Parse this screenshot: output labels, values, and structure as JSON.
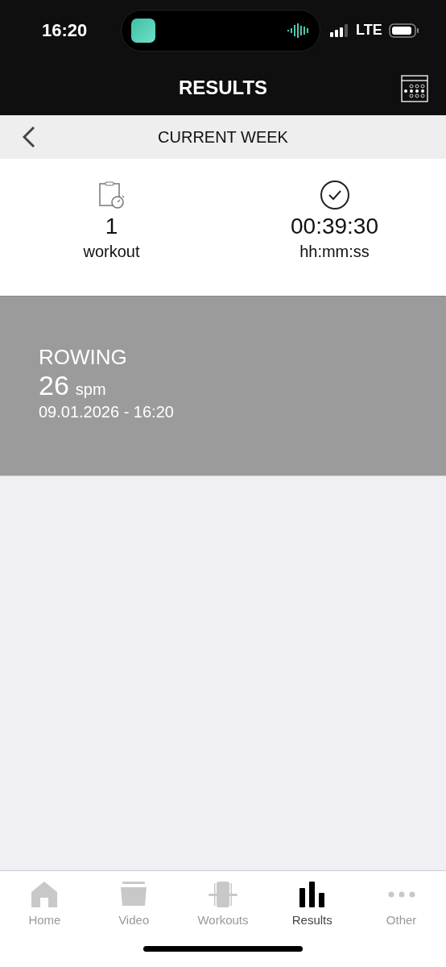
{
  "status_bar": {
    "time": "16:20",
    "network": "LTE"
  },
  "header": {
    "title": "RESULTS"
  },
  "subheader": {
    "title": "CURRENT WEEK"
  },
  "summary": [
    {
      "kind": "count",
      "value": "1",
      "label": "workout"
    },
    {
      "kind": "duration",
      "value": "00:39:30",
      "label": "hh:mm:ss"
    }
  ],
  "workouts": [
    {
      "name": "ROWING",
      "value": "26",
      "unit": "spm",
      "date": "09.01.2026 - 16:20"
    }
  ],
  "tabs": [
    {
      "kind": "home",
      "label": "Home",
      "selected": false
    },
    {
      "kind": "video",
      "label": "Video",
      "selected": false
    },
    {
      "kind": "workouts",
      "label": "Workouts",
      "selected": false
    },
    {
      "kind": "results",
      "label": "Results",
      "selected": true
    },
    {
      "kind": "other",
      "label": "Other",
      "selected": false
    }
  ]
}
